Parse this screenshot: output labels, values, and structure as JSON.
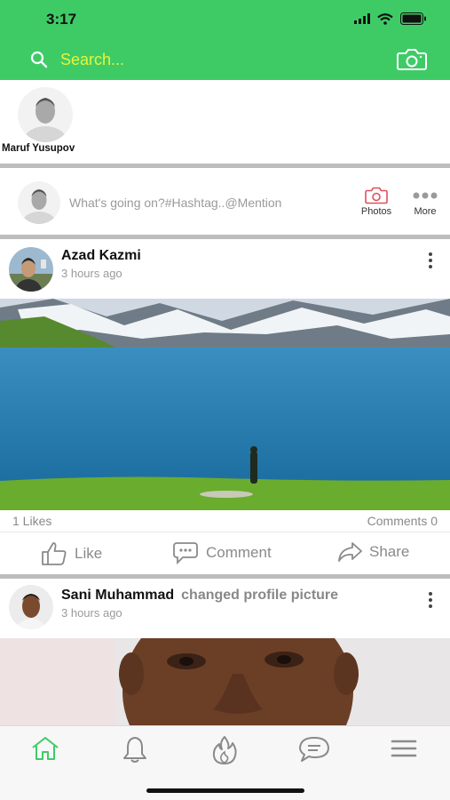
{
  "status_bar": {
    "time": "3:17",
    "icons": [
      "signal-icon",
      "wifi-icon",
      "battery-icon"
    ]
  },
  "header": {
    "search_placeholder": "Search...",
    "search_icon": "search-icon",
    "camera_icon": "camera-icon",
    "background_color": "#3ecb66",
    "search_text_color": "#e6f53a"
  },
  "stories": [
    {
      "name": "Maruf Yusupov"
    }
  ],
  "composer": {
    "placeholder": "What's going on?#Hashtag..@Mention",
    "photos_label": "Photos",
    "more_label": "More"
  },
  "posts": [
    {
      "author": "Azad Kazmi",
      "action": "",
      "time": "3 hours ago",
      "likes": "1 Likes",
      "comments": "Comments 0",
      "image": "lake-landscape"
    },
    {
      "author": "Sani Muhammad",
      "action": "changed profile picture",
      "time": "3 hours ago",
      "image": "profile-portrait"
    }
  ],
  "post_actions": {
    "like": "Like",
    "comment": "Comment",
    "share": "Share"
  },
  "tabbar": {
    "tabs": [
      "home-icon",
      "bell-icon",
      "flame-icon",
      "chat-icon",
      "menu-icon"
    ],
    "active_color": "#3ecb66"
  }
}
